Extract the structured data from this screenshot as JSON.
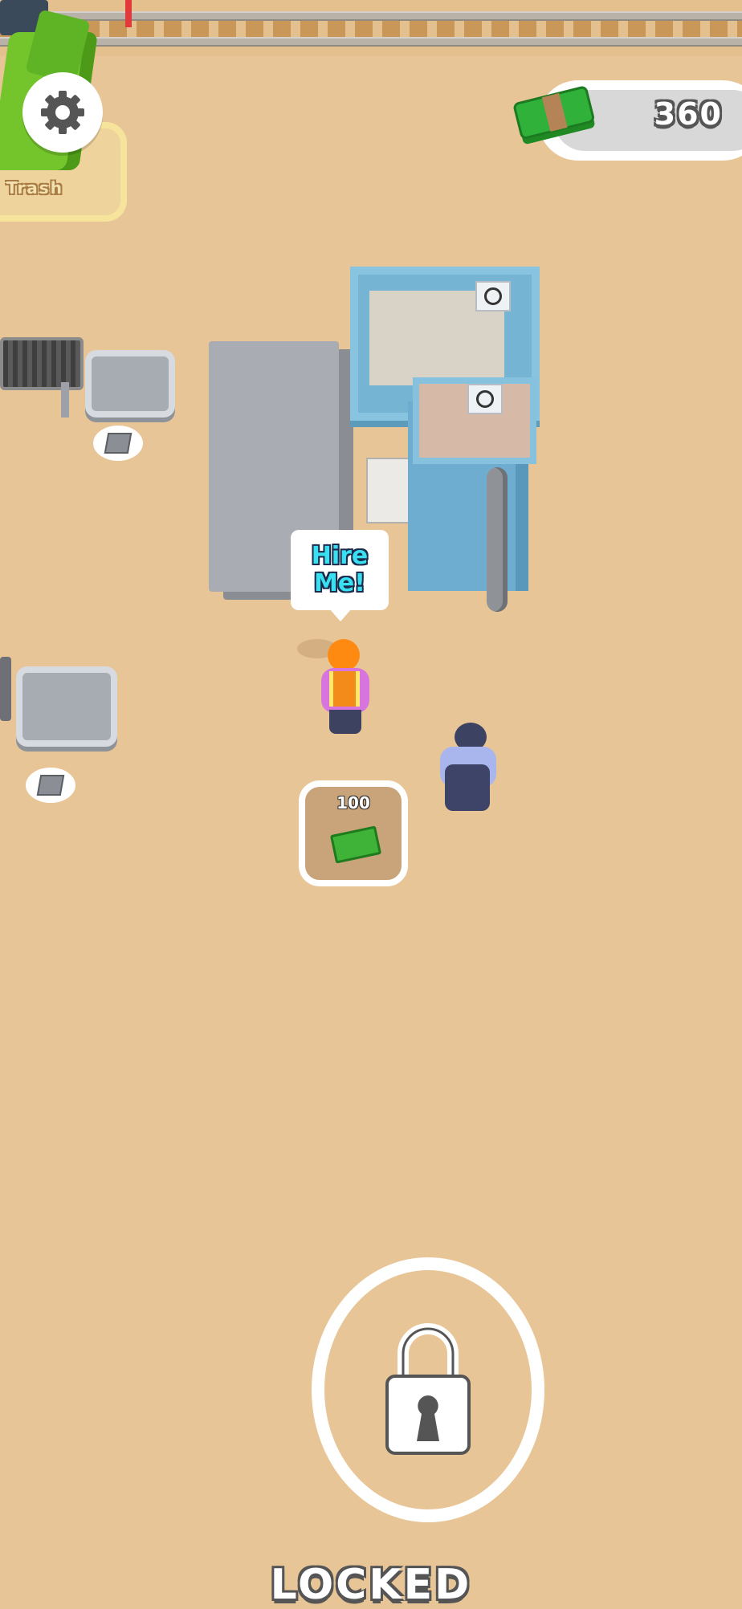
{
  "hud": {
    "money": "360",
    "settings_icon": "gear-icon",
    "cash_icon": "cash-stack-icon"
  },
  "trash": {
    "label": "Trash"
  },
  "npc": {
    "speech": "Hire\nMe!"
  },
  "hire_pad": {
    "cost": "100"
  },
  "lock": {
    "label": "LOCKED",
    "icon": "padlock-icon"
  },
  "colors": {
    "ground": "#e8c596",
    "machine": "#76b4d4",
    "cash_green": "#3fb337",
    "bubble_text": "#38e0f0"
  }
}
